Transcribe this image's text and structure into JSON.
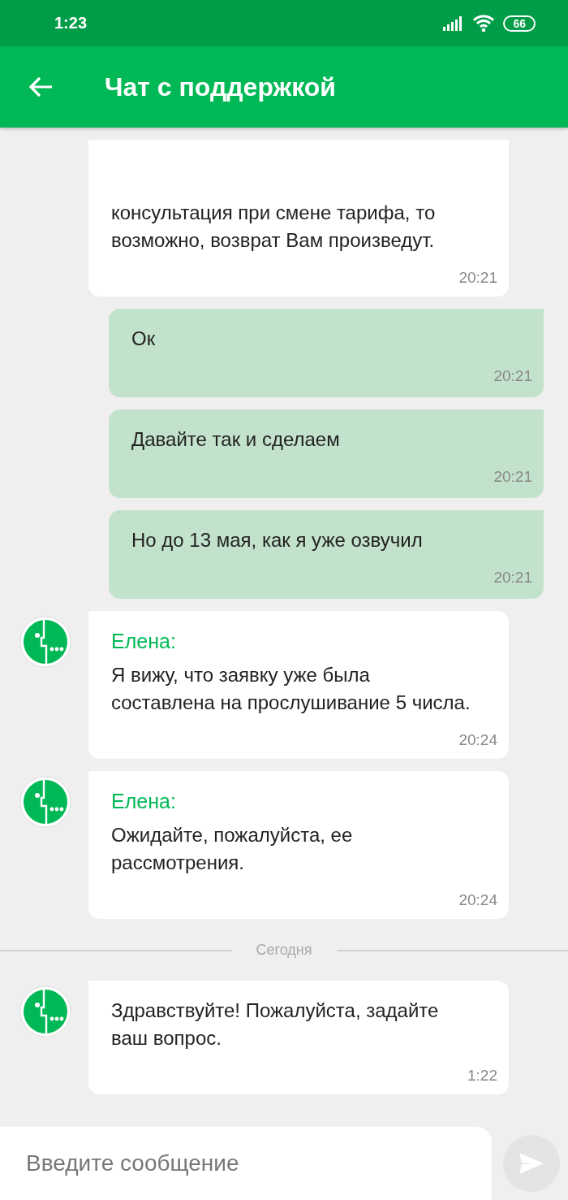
{
  "status_bar": {
    "time": "1:23",
    "battery": "66"
  },
  "header": {
    "title": "Чат с поддержкой"
  },
  "messages": [
    {
      "kind": "incoming",
      "show_avatar": false,
      "text": "консультация при смене тарифа, то возможно, возврат Вам произведут.",
      "time": "20:21"
    },
    {
      "kind": "outgoing",
      "text": "Ок",
      "time": "20:21"
    },
    {
      "kind": "outgoing",
      "text": "Давайте так и сделаем",
      "time": "20:21"
    },
    {
      "kind": "outgoing",
      "text": "Но до 13 мая, как я уже озвучил",
      "time": "20:21"
    },
    {
      "kind": "incoming",
      "show_avatar": true,
      "sender": "Елена:",
      "text": "Я вижу, что заявку уже была составлена на прослушивание 5 числа.",
      "time": "20:24"
    },
    {
      "kind": "incoming",
      "show_avatar": true,
      "sender": "Елена:",
      "text": "Ожидайте, пожалуйста, ее рассмотрения.",
      "time": "20:24"
    },
    {
      "kind": "date_divider",
      "text": "Сегодня"
    },
    {
      "kind": "incoming",
      "show_avatar": true,
      "text": "Здравствуйте! Пожалуйста, задайте ваш вопрос.",
      "time": "1:22"
    }
  ],
  "composer": {
    "placeholder": "Введите сообщение"
  }
}
